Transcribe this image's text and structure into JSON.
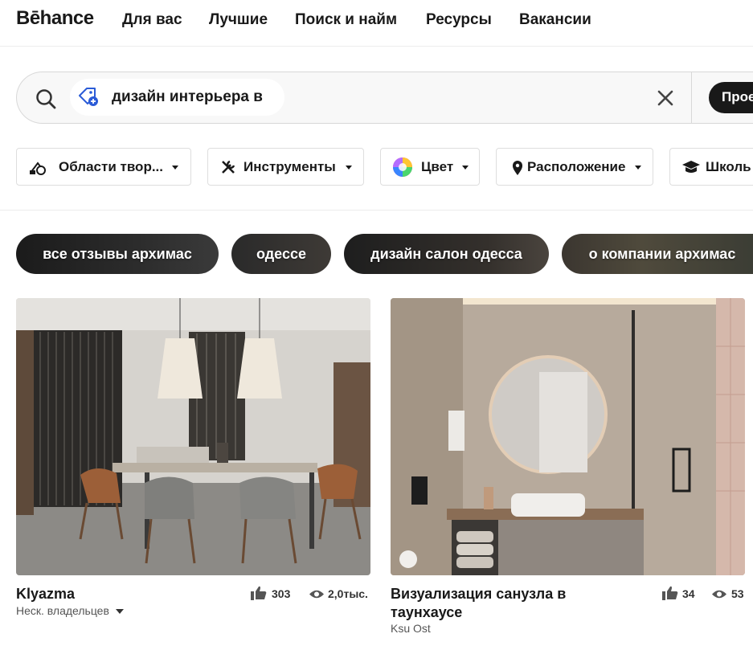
{
  "nav": {
    "logo": "Bēhance",
    "items": [
      "Для вас",
      "Лучшие",
      "Поиск и найм",
      "Ресурсы",
      "Вакансии"
    ]
  },
  "search": {
    "query": "дизайн интерьера в",
    "submit_label": "Прое"
  },
  "filters": [
    {
      "label": "Области твор...",
      "icon": "creative-fields-icon"
    },
    {
      "label": "Инструменты",
      "icon": "tools-icon"
    },
    {
      "label": "Цвет",
      "icon": "color-wheel-icon"
    },
    {
      "label": "Расположение",
      "icon": "location-pin-icon"
    },
    {
      "label": "Школь",
      "icon": "graduation-cap-icon"
    }
  ],
  "suggestions": [
    "все отзывы архимас",
    "одессе",
    "дизайн салон одесса",
    "о компании архимас"
  ],
  "projects": [
    {
      "title": "Klyazma",
      "owner": "Неск. владельцев",
      "likes": "303",
      "views": "2,0тыс."
    },
    {
      "title": "Визуализация санузла в таунхаусе",
      "owner": "Ksu Ost",
      "likes": "34",
      "views": "53"
    }
  ],
  "colors": {
    "text": "#191919",
    "button_dark": "#191919"
  }
}
